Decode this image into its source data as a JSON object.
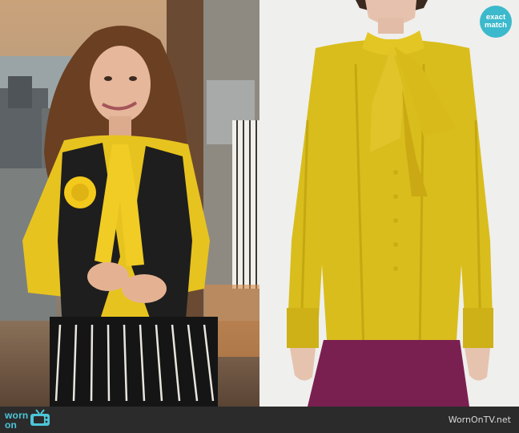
{
  "badge": {
    "line1": "exact",
    "line2": "match"
  },
  "footer": {
    "logo_top": "worn",
    "logo_bottom": "on",
    "logo_icon": "tv-icon",
    "credit": "WornOnTV.net"
  },
  "colors": {
    "brand": "#3cb9cc",
    "footer_bg": "#2b2b2b",
    "blouse_yellow": "#d9bd1c",
    "skirt_plum": "#7a2050"
  }
}
